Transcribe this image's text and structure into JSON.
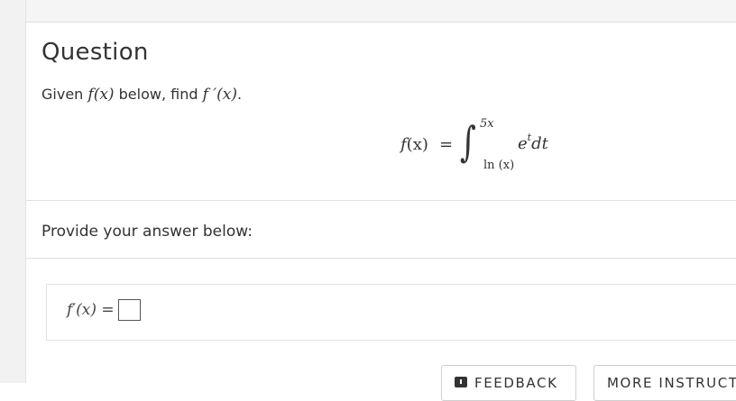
{
  "question": {
    "title": "Question",
    "prompt_pre": "Given ",
    "prompt_f": "f",
    "prompt_x": "(x)",
    "prompt_mid": " below, find ",
    "prompt_fprime": "f ′",
    "prompt_x2": "(x)",
    "prompt_end": "."
  },
  "formula": {
    "lhs_f": "f",
    "lhs_arg": "(x)",
    "equals": "=",
    "integral_sign": "∫",
    "upper_limit": "5x",
    "lower_ln": "ln",
    "lower_arg": "(x)",
    "integrand_base": "e",
    "integrand_exp": "t",
    "integrand_dt": "dt"
  },
  "answer": {
    "label": "Provide your answer below:",
    "expr_f": "f′(x)",
    "expr_eq": "=",
    "input_value": ""
  },
  "buttons": {
    "feedback_label": "FEEDBACK",
    "more_label": "MORE INSTRUCTION"
  }
}
